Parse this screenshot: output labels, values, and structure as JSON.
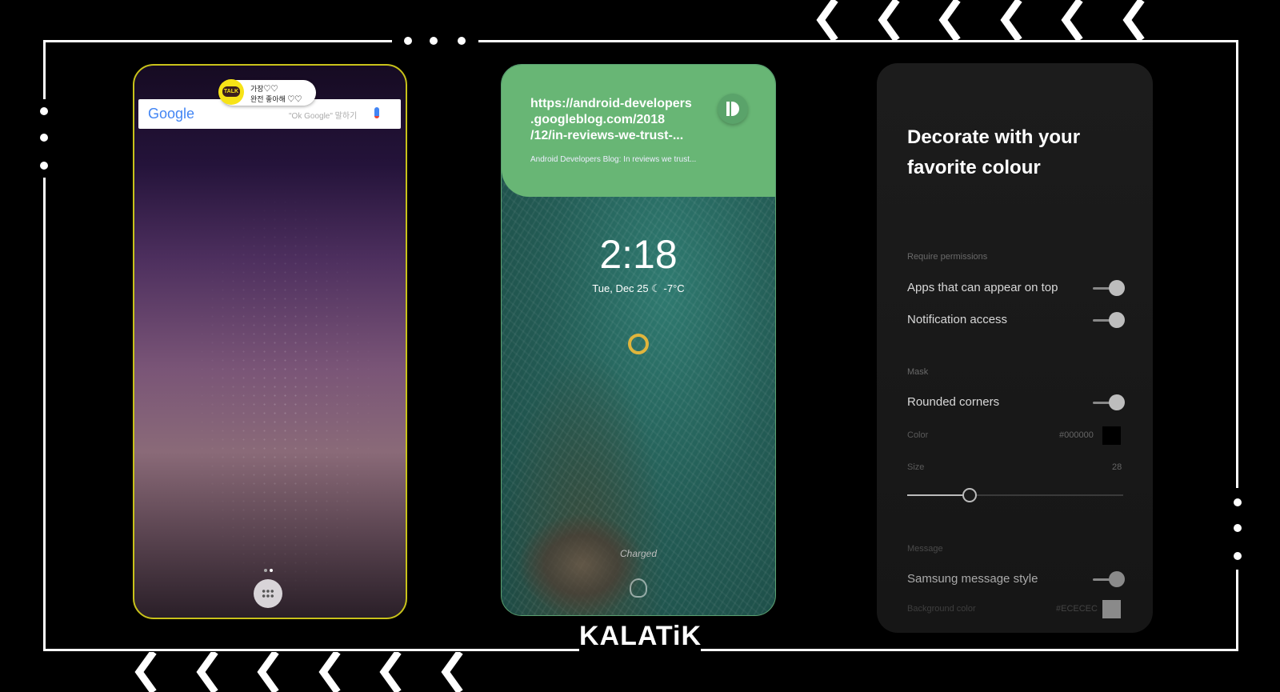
{
  "brand": {
    "logo_text": "KALATiK"
  },
  "phone_launcher": {
    "notification": {
      "app_icon": "kakaotalk-icon",
      "icon_text": "TALK",
      "line1": "가장♡♡",
      "line2": "완전 좋아해 ♡♡"
    },
    "search": {
      "logo": "Google",
      "placeholder": "\"Ok Google\" 말하기",
      "mic_icon": "mic-icon"
    },
    "page_indicator": {
      "pages": 2,
      "current": 1
    },
    "app_drawer_icon": "apps-grid-icon",
    "border_color": "#c8c21a"
  },
  "phone_lockscreen": {
    "notification": {
      "url": "https://android-developers.googleblog.com/2018/12/in-reviews-we-trust-...",
      "url_lines": [
        "https://android-developers",
        ".googleblog.com/2018",
        "/12/in-reviews-we-trust-..."
      ],
      "subtitle": "Android Developers Blog: In reviews we trust...",
      "app_icon": "pushbullet-icon",
      "color": "#68b675"
    },
    "time": "2:18",
    "date": "Tue, Dec 25",
    "weather_icon": "moon-icon",
    "temperature": "-7°C",
    "status": "Charged",
    "fingerprint_icon": "fingerprint-icon"
  },
  "phone_settings": {
    "title_line1": "Decorate with your",
    "title_line2": "favorite colour",
    "sections": {
      "permissions": {
        "label": "Require permissions",
        "items": [
          {
            "label": "Apps that can appear on top",
            "on": true
          },
          {
            "label": "Notification access",
            "on": true
          }
        ]
      },
      "mask": {
        "label": "Mask",
        "rounded_corners": {
          "label": "Rounded corners",
          "on": true
        },
        "color": {
          "label": "Color",
          "value": "#000000"
        },
        "size": {
          "label": "Size",
          "value": "28",
          "fraction": 0.29
        }
      },
      "message": {
        "label": "Message",
        "samsung_style": {
          "label": "Samsung message style",
          "on": true
        },
        "background_color": {
          "label": "Background color",
          "value": "#ECECEC"
        }
      }
    }
  }
}
